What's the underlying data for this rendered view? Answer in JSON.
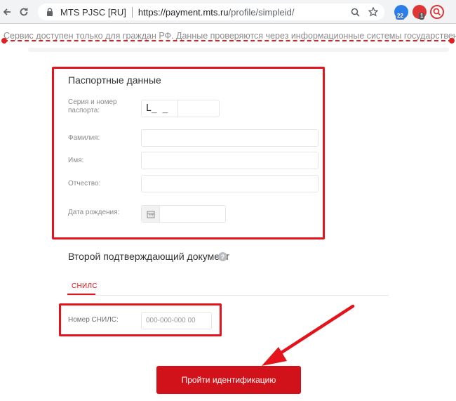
{
  "browser": {
    "site_name": "MTS PJSC [RU]",
    "url_host": "https://payment.mts.ru",
    "url_path": "/profile/simpleid/",
    "ext_badge_1": "22",
    "ext_badge_2": "1"
  },
  "notice": {
    "text": "Сервис доступен только для граждан РФ. Данные проверяются через информационные системы государственных органов"
  },
  "passport": {
    "title": "Паспортные данные",
    "series_label": "Серия и номер паспорта:",
    "series_value": "L_ _",
    "surname_label": "Фамилия:",
    "name_label": "Имя:",
    "patronymic_label": "Отчество:",
    "birthdate_label": "Дата рождения:"
  },
  "second_doc": {
    "title": "Второй подтверждающий документ",
    "help": "?",
    "tab_snils": "СНИЛС",
    "snils_label": "Номер СНИЛС:",
    "snils_placeholder": "000-000-000 00"
  },
  "submit": {
    "label": "Пройти идентификацию"
  },
  "colors": {
    "accent": "#e3141b",
    "button": "#d2121a"
  }
}
